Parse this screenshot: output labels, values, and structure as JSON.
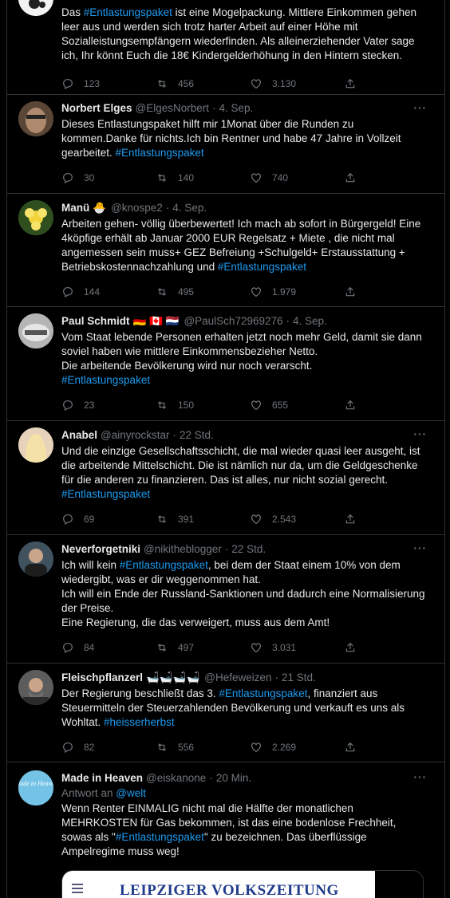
{
  "tweets": [
    {
      "name": "",
      "handle": "",
      "time": "",
      "text_parts": [
        {
          "t": "Das "
        },
        {
          "t": "#Entlastungspaket",
          "tag": true
        },
        {
          "t": " ist eine Mogelpackung. Mittlere Einkommen gehen leer aus und werden sich trotz harter Arbeit auf einer Höhe mit Sozialleistungsempfängern wiederfinden. Als alleinerziehender Vater sage ich, Ihr könnt Euch die 18€ Kindergelderhöhung in den Hintern stecken."
        }
      ],
      "replies": "123",
      "retweets": "456",
      "likes": "3.130"
    },
    {
      "name": "Norbert Elges",
      "handle": "@ElgesNorbert",
      "time": "4. Sep.",
      "text_parts": [
        {
          "t": "Dieses Entlastungspaket hilft mir 1Monat über die Runden zu kommen.Danke für nichts.Ich bin Rentner und habe 47 Jahre in Vollzeit gearbeitet. "
        },
        {
          "t": "#Entlastungspaket",
          "tag": true
        }
      ],
      "replies": "30",
      "retweets": "140",
      "likes": "740"
    },
    {
      "name": "Manü",
      "flags": "🐣",
      "handle": "@knospe2",
      "time": "4. Sep.",
      "text_parts": [
        {
          "t": "Arbeiten gehen- völlig überbewertet! Ich mach ab sofort in Bürgergeld! Eine 4köpfige erhält ab Januar 2000 EUR Regelsatz + Miete , die nicht mal angemessen sein muss+ GEZ Befreiung +Schulgeld+ Erstausstattung + Betriebskostennachzahlung und "
        },
        {
          "t": "#Entlastungspaket",
          "tag": true
        }
      ],
      "replies": "144",
      "retweets": "495",
      "likes": "1.979"
    },
    {
      "name": "Paul Schmidt",
      "flags": "🇩🇪 🇨🇦 🇳🇱",
      "handle": "@PaulSch72969276",
      "time": "4. Sep.",
      "text_parts": [
        {
          "t": "Vom Staat lebende Personen erhalten jetzt noch mehr Geld, damit sie dann soviel haben wie mittlere Einkommensbezieher Netto.\nDie arbeitende Bevölkerung wird nur noch verarscht.\n"
        },
        {
          "t": "#Entlastungspaket",
          "tag": true
        }
      ],
      "replies": "23",
      "retweets": "150",
      "likes": "655"
    },
    {
      "name": "Anabel",
      "handle": "@ainyrockstar",
      "time": "22 Std.",
      "text_parts": [
        {
          "t": "Und die einzige Gesellschaftsschicht, die mal wieder quasi leer ausgeht, ist die arbeitende Mittelschicht. Die ist nämlich nur da, um die Geldgeschenke für die anderen zu finanzieren. Das ist alles, nur nicht sozial gerecht.\n"
        },
        {
          "t": "#Entlastungspaket",
          "tag": true
        }
      ],
      "replies": "69",
      "retweets": "391",
      "likes": "2.543"
    },
    {
      "name": "Neverforgetniki",
      "handle": "@nikitheblogger",
      "time": "22 Std.",
      "text_parts": [
        {
          "t": "Ich will kein "
        },
        {
          "t": "#Entlastungspaket",
          "tag": true
        },
        {
          "t": ", bei dem der Staat einem 10% von dem wiedergibt, was er dir weggenommen hat.\nIch will ein Ende der Russland-Sanktionen und dadurch eine Normalisierung der Preise.\nEine Regierung, die das verweigert, muss aus dem Amt!"
        }
      ],
      "replies": "84",
      "retweets": "497",
      "likes": "3.031"
    },
    {
      "name": "Fleischpflanzerl",
      "flags": "🛁🛁🛁🛁",
      "handle": "@Hefeweizen",
      "time": "21 Std.",
      "text_parts": [
        {
          "t": "Der Regierung beschließt das 3. "
        },
        {
          "t": "#Entlastungspaket",
          "tag": true
        },
        {
          "t": ", finanziert aus Steuermitteln der Steuerzahlenden Bevölkerung und verkauft es uns als Wohltat. "
        },
        {
          "t": "#heisserherbst",
          "tag": true
        }
      ],
      "replies": "82",
      "retweets": "556",
      "likes": "2.269"
    },
    {
      "name": "Made in Heaven",
      "handle": "@eiskanone",
      "time": "20 Min.",
      "reply_to_prefix": "Antwort an ",
      "reply_to": "@welt",
      "text_parts": [
        {
          "t": "Wenn Renter EINMALIG nicht mal die Hälfte der monatlichen MEHRKOSTEN für Gas bekommen, ist das eine bodenlose Frechheit, sowas als \""
        },
        {
          "t": "#Entlastungspaket",
          "tag": true
        },
        {
          "t": "\" zu bezeichnen. Das überflüssige Ampelregime muss weg!"
        }
      ],
      "card_brand": "LEIPZIGER VOLKSZEITUNG",
      "avatar_text": "Made in Heaven"
    }
  ],
  "more_label": "···",
  "icons": {
    "reply": "reply-icon",
    "retweet": "retweet-icon",
    "like": "heart-icon",
    "share": "share-icon"
  },
  "colors": {
    "background": "#000000",
    "link": "#1d9bf0",
    "muted": "#71767b",
    "border": "#2f3336"
  }
}
